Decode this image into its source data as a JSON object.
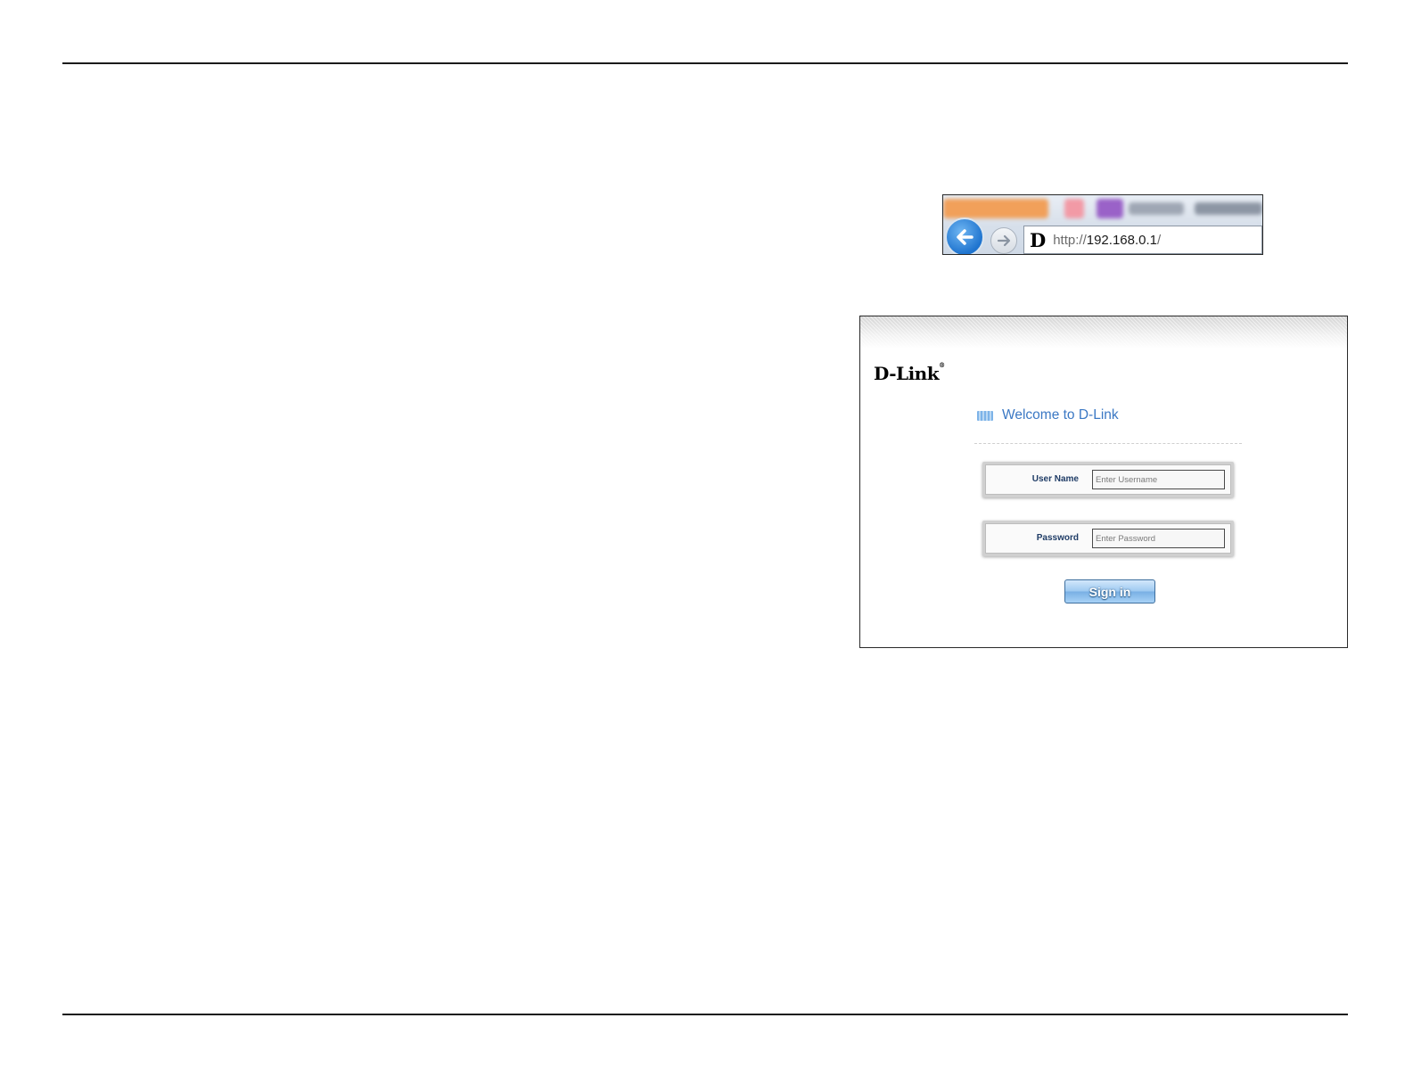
{
  "browser": {
    "url_protocol": "http://",
    "url_host": "192.168.0.1",
    "url_path": "/",
    "favicon_letter": "D",
    "back_icon": "back-arrow-icon",
    "forward_icon": "forward-arrow-icon"
  },
  "login": {
    "logo_text": "D-Link",
    "logo_mark": "®",
    "welcome_text": "Welcome to D-Link",
    "username_label": "User Name",
    "username_placeholder": "Enter Username",
    "username_value": "",
    "password_label": "Password",
    "password_placeholder": "Enter Password",
    "password_value": "",
    "signin_label": "Sign in"
  },
  "colors": {
    "welcome_text": "#3b78c4",
    "field_label": "#1f3c66",
    "signin_button": "#79b0e4",
    "back_button": "#1f74cf"
  }
}
